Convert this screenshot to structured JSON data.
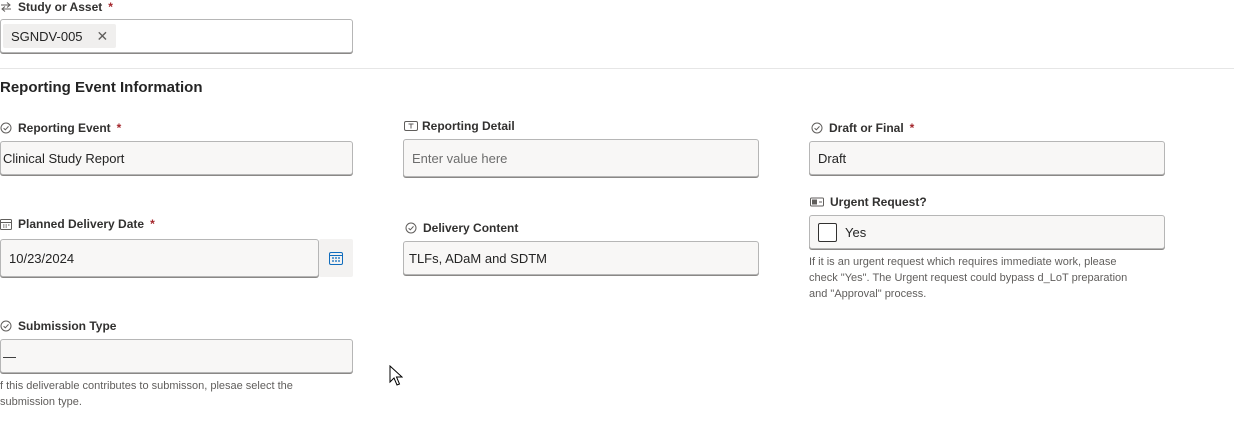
{
  "study": {
    "label": "Study or Asset",
    "required_mark": "*",
    "chip_value": "SGNDV-005",
    "chip_remove": "✕"
  },
  "section": {
    "title": "Reporting Event Information"
  },
  "reporting_event": {
    "label": "Reporting Event",
    "required_mark": "*",
    "value": "Clinical Study Report"
  },
  "reporting_detail": {
    "label": "Reporting Detail",
    "placeholder": "Enter value here"
  },
  "draft_final": {
    "label": "Draft or Final",
    "required_mark": "*",
    "value": "Draft"
  },
  "planned_delivery": {
    "label": "Planned Delivery Date",
    "required_mark": "*",
    "value": "10/23/2024"
  },
  "delivery_content": {
    "label": "Delivery Content",
    "value": "TLFs, ADaM and SDTM"
  },
  "urgent": {
    "label": "Urgent Request?",
    "checkbox_label": "Yes",
    "checked": false,
    "help_line1": "If it is an urgent request which requires immediate work, please",
    "help_line2": "check \"Yes\". The Urgent request could bypass d_LoT preparation",
    "help_line3": "and \"Approval\" process."
  },
  "submission_type": {
    "label": "Submission Type",
    "value": "—",
    "help_line1": "f this deliverable contributes to submisson, plesae select the",
    "help_line2": "submission type."
  },
  "icons": {
    "study": "swap-arrows-icon",
    "choice": "check-circle-icon",
    "text": "text-field-icon",
    "date": "calendar-icon",
    "toggle": "toggle-icon",
    "cursor": "mouse-pointer-icon"
  }
}
